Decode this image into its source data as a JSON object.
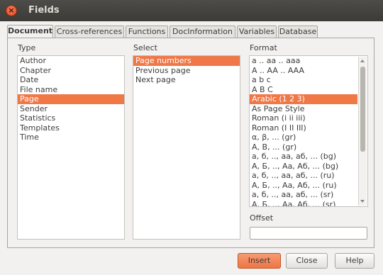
{
  "window": {
    "title": "Fields",
    "close_symbol": "×"
  },
  "tabs": [
    {
      "label": "Document",
      "active": true
    },
    {
      "label": "Cross-references",
      "active": false
    },
    {
      "label": "Functions",
      "active": false
    },
    {
      "label": "DocInformation",
      "active": false
    },
    {
      "label": "Variables",
      "active": false
    },
    {
      "label": "Database",
      "active": false
    }
  ],
  "type": {
    "label": "Type",
    "items": [
      "Author",
      "Chapter",
      "Date",
      "File name",
      "Page",
      "Sender",
      "Statistics",
      "Templates",
      "Time"
    ],
    "selected": "Page"
  },
  "select": {
    "label": "Select",
    "items": [
      "Page numbers",
      "Previous page",
      "Next page"
    ],
    "selected": "Page numbers"
  },
  "format": {
    "label": "Format",
    "items": [
      "a .. aa .. aaa",
      "A .. AA .. AAA",
      "a b c",
      "A B C",
      "Arabic (1 2 3)",
      "As Page Style",
      "Roman (i ii iii)",
      "Roman (I II III)",
      "α, β, ... (gr)",
      "Α, Β, ... (gr)",
      "а, б, .., аа, аб, ... (bg)",
      "А, Б, .., Аа, Аб, ... (bg)",
      "а, б, .., аа, аб, ... (ru)",
      "А, Б, .., Аа, Аб, ... (ru)",
      "а, б, .., аа, аб, ... (sr)",
      "А, Б, .., Аа, Аб, ... (sr)"
    ],
    "selected": "Arabic (1 2 3)"
  },
  "offset": {
    "label": "Offset",
    "value": ""
  },
  "buttons": {
    "insert": "Insert",
    "close": "Close",
    "help": "Help"
  },
  "colors": {
    "accent": "#f07746",
    "titlebar": "#3c3b37"
  }
}
